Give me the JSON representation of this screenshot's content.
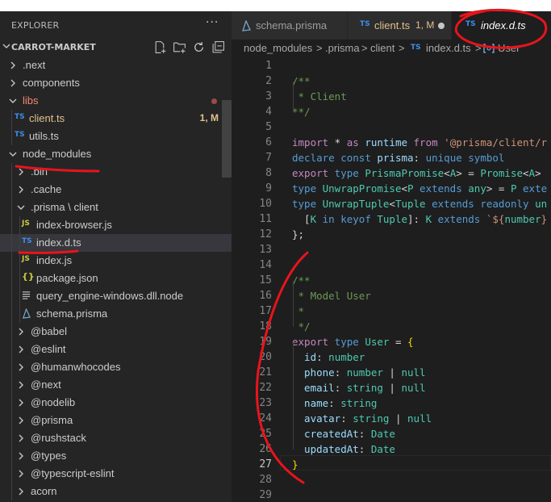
{
  "sidebar": {
    "title": "EXPLORER",
    "more": "···",
    "project": "CARROT-MARKET",
    "items": [
      {
        "label": ".next",
        "kind": "folder",
        "expanded": false,
        "depth": 0
      },
      {
        "label": "components",
        "kind": "folder",
        "expanded": false,
        "depth": 0
      },
      {
        "label": "libs",
        "kind": "folder",
        "expanded": true,
        "depth": 0,
        "state": "error"
      },
      {
        "label": "client.ts",
        "kind": "ts",
        "depth": 1,
        "badge": "1, M",
        "state": "modified"
      },
      {
        "label": "utils.ts",
        "kind": "ts",
        "depth": 1
      },
      {
        "label": "node_modules",
        "kind": "folder",
        "expanded": true,
        "depth": 0
      },
      {
        "label": ".bin",
        "kind": "folder",
        "expanded": false,
        "depth": 1
      },
      {
        "label": ".cache",
        "kind": "folder",
        "expanded": false,
        "depth": 1
      },
      {
        "label": ".prisma \\ client",
        "kind": "folder",
        "expanded": true,
        "depth": 1
      },
      {
        "label": "index-browser.js",
        "kind": "js",
        "depth": 2
      },
      {
        "label": "index.d.ts",
        "kind": "ts",
        "depth": 2,
        "selected": true
      },
      {
        "label": "index.js",
        "kind": "js",
        "depth": 2
      },
      {
        "label": "package.json",
        "kind": "json",
        "depth": 2
      },
      {
        "label": "query_engine-windows.dll.node",
        "kind": "file",
        "depth": 2
      },
      {
        "label": "schema.prisma",
        "kind": "prisma",
        "depth": 2
      },
      {
        "label": "@babel",
        "kind": "folder",
        "expanded": false,
        "depth": 1
      },
      {
        "label": "@eslint",
        "kind": "folder",
        "expanded": false,
        "depth": 1
      },
      {
        "label": "@humanwhocodes",
        "kind": "folder",
        "expanded": false,
        "depth": 1
      },
      {
        "label": "@next",
        "kind": "folder",
        "expanded": false,
        "depth": 1
      },
      {
        "label": "@nodelib",
        "kind": "folder",
        "expanded": false,
        "depth": 1
      },
      {
        "label": "@prisma",
        "kind": "folder",
        "expanded": false,
        "depth": 1
      },
      {
        "label": "@rushstack",
        "kind": "folder",
        "expanded": false,
        "depth": 1
      },
      {
        "label": "@types",
        "kind": "folder",
        "expanded": false,
        "depth": 1
      },
      {
        "label": "@typescript-eslint",
        "kind": "folder",
        "expanded": false,
        "depth": 1
      },
      {
        "label": "acorn",
        "kind": "folder",
        "expanded": false,
        "depth": 1
      }
    ]
  },
  "tabs": [
    {
      "label": "schema.prisma",
      "icon": "prisma-icon"
    },
    {
      "label": "client.ts",
      "icon": "TS",
      "suffix": "1, M",
      "modified": true
    },
    {
      "label": "index.d.ts",
      "icon": "TS",
      "active": true
    }
  ],
  "breadcrumb": [
    "node_modules",
    ">",
    ".prisma",
    ">",
    "client",
    ">",
    "index.d.ts",
    ">",
    "User"
  ],
  "icons": {
    "ts": "TS",
    "js": "JS",
    "json": "{}"
  },
  "editor": {
    "line_numbers": [
      "1",
      "2",
      "3",
      "4",
      "5",
      "6",
      "7",
      "8",
      "9",
      "10",
      "11",
      "12",
      "13",
      "14",
      "15",
      "16",
      "17",
      "18",
      "19",
      "20",
      "21",
      "22",
      "23",
      "24",
      "25",
      "26",
      "27",
      "28",
      "29"
    ],
    "current_line": "27",
    "lines": [
      [],
      [
        {
          "c": "c",
          "t": "/**"
        }
      ],
      [
        {
          "c": "c",
          "t": " * Client"
        }
      ],
      [
        {
          "c": "c",
          "t": "**/"
        }
      ],
      [],
      [
        {
          "c": "kc",
          "t": "import"
        },
        {
          "c": "p",
          "t": " * "
        },
        {
          "c": "kc",
          "t": "as"
        },
        {
          "c": "v",
          "t": " runtime "
        },
        {
          "c": "kc",
          "t": "from"
        },
        {
          "c": "s",
          "t": " '@prisma/client/r"
        }
      ],
      [
        {
          "c": "k",
          "t": "declare"
        },
        {
          "c": "k",
          "t": " const"
        },
        {
          "c": "v",
          "t": " prisma"
        },
        {
          "c": "p",
          "t": ": "
        },
        {
          "c": "k",
          "t": "unique"
        },
        {
          "c": "k",
          "t": " symbol"
        }
      ],
      [
        {
          "c": "kc",
          "t": "export"
        },
        {
          "c": "k",
          "t": " type"
        },
        {
          "c": "t",
          "t": " PrismaPromise"
        },
        {
          "c": "p",
          "t": "<"
        },
        {
          "c": "t",
          "t": "A"
        },
        {
          "c": "p",
          "t": "> = "
        },
        {
          "c": "t",
          "t": "Promise"
        },
        {
          "c": "p",
          "t": "<"
        },
        {
          "c": "t",
          "t": "A"
        },
        {
          "c": "p",
          "t": ">"
        }
      ],
      [
        {
          "c": "k",
          "t": "type"
        },
        {
          "c": "t",
          "t": " UnwrapPromise"
        },
        {
          "c": "p",
          "t": "<"
        },
        {
          "c": "t",
          "t": "P"
        },
        {
          "c": "k",
          "t": " extends"
        },
        {
          "c": "t",
          "t": " any"
        },
        {
          "c": "p",
          "t": "> = "
        },
        {
          "c": "t",
          "t": "P"
        },
        {
          "c": "k",
          "t": " exte"
        }
      ],
      [
        {
          "c": "k",
          "t": "type"
        },
        {
          "c": "t",
          "t": " UnwrapTuple"
        },
        {
          "c": "p",
          "t": "<"
        },
        {
          "c": "t",
          "t": "Tuple"
        },
        {
          "c": "k",
          "t": " extends"
        },
        {
          "c": "k",
          "t": " readonly"
        },
        {
          "c": "t",
          "t": " un"
        }
      ],
      [
        {
          "c": "p",
          "t": "  ["
        },
        {
          "c": "t",
          "t": "K"
        },
        {
          "c": "k",
          "t": " in"
        },
        {
          "c": "k",
          "t": " keyof"
        },
        {
          "c": "t",
          "t": " Tuple"
        },
        {
          "c": "p",
          "t": "]: "
        },
        {
          "c": "t",
          "t": "K"
        },
        {
          "c": "k",
          "t": " extends"
        },
        {
          "c": "s",
          "t": " `${"
        },
        {
          "c": "t",
          "t": "number"
        },
        {
          "c": "s",
          "t": "}"
        }
      ],
      [
        {
          "c": "p",
          "t": "};"
        }
      ],
      [],
      [],
      [
        {
          "c": "c",
          "t": "/**"
        }
      ],
      [
        {
          "c": "c",
          "t": " * Model User"
        }
      ],
      [
        {
          "c": "c",
          "t": " *"
        }
      ],
      [
        {
          "c": "c",
          "t": " */"
        }
      ],
      [
        {
          "c": "kc",
          "t": "export"
        },
        {
          "c": "k",
          "t": " type"
        },
        {
          "c": "t",
          "t": " User"
        },
        {
          "c": "p",
          "t": " = "
        },
        {
          "c": "br",
          "t": "{"
        }
      ],
      [
        {
          "c": "v",
          "t": "  id"
        },
        {
          "c": "p",
          "t": ": "
        },
        {
          "c": "t",
          "t": "number"
        }
      ],
      [
        {
          "c": "v",
          "t": "  phone"
        },
        {
          "c": "p",
          "t": ": "
        },
        {
          "c": "t",
          "t": "number"
        },
        {
          "c": "p",
          "t": " | "
        },
        {
          "c": "t",
          "t": "null"
        }
      ],
      [
        {
          "c": "v",
          "t": "  email"
        },
        {
          "c": "p",
          "t": ": "
        },
        {
          "c": "t",
          "t": "string"
        },
        {
          "c": "p",
          "t": " | "
        },
        {
          "c": "t",
          "t": "null"
        }
      ],
      [
        {
          "c": "v",
          "t": "  name"
        },
        {
          "c": "p",
          "t": ": "
        },
        {
          "c": "t",
          "t": "string"
        }
      ],
      [
        {
          "c": "v",
          "t": "  avatar"
        },
        {
          "c": "p",
          "t": ": "
        },
        {
          "c": "t",
          "t": "string"
        },
        {
          "c": "p",
          "t": " | "
        },
        {
          "c": "t",
          "t": "null"
        }
      ],
      [
        {
          "c": "v",
          "t": "  createdAt"
        },
        {
          "c": "p",
          "t": ": "
        },
        {
          "c": "t",
          "t": "Date"
        }
      ],
      [
        {
          "c": "v",
          "t": "  updatedAt"
        },
        {
          "c": "p",
          "t": ": "
        },
        {
          "c": "t",
          "t": "Date"
        }
      ],
      [
        {
          "c": "br",
          "t": "}"
        }
      ],
      [],
      []
    ]
  },
  "colors": {
    "annotation": "#e8141c",
    "ts_icon": "#3b8eea",
    "js_icon": "#cbcb41",
    "modified": "#e2c08d"
  }
}
